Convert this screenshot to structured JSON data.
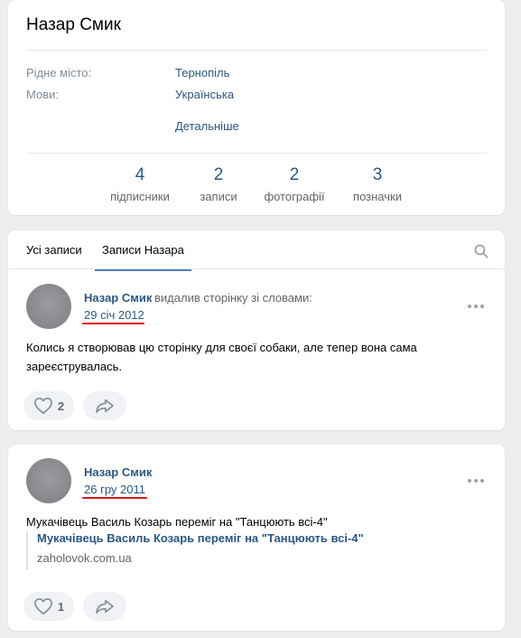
{
  "profile": {
    "name": "Назар Смик",
    "info": [
      {
        "label": "Рідне місто:",
        "value": "Тернопіль"
      },
      {
        "label": "Мови:",
        "value": "Українська"
      }
    ],
    "more_link": "Детальніше",
    "counters": [
      {
        "num": "4",
        "label": "підписники"
      },
      {
        "num": "2",
        "label": "записи"
      },
      {
        "num": "2",
        "label": "фотографії"
      },
      {
        "num": "3",
        "label": "позначки"
      }
    ]
  },
  "wall": {
    "tabs": [
      "Усі записи",
      "Записи Назара"
    ],
    "active_tab": "Записи Назара",
    "search_icon": "search-icon"
  },
  "posts": [
    {
      "author": "Назар Смик",
      "action": "видалив сторінку зі словами:",
      "date": "29 січ 2012",
      "text": "Колись я створював цю сторінку для своєї собаки, але тепер вона сама зареєструвалась.",
      "likes": "2"
    },
    {
      "author": "Назар Смик",
      "action": "",
      "date": "26 гру 2011",
      "text": "Мукачівець Василь Козарь переміг на \"Танцюють всі-4\"",
      "link_title": "Мукачівець Василь Козарь переміг на \"Танцюють всі-4\"",
      "link_domain": "zaholovok.com.ua",
      "likes": "1"
    }
  ],
  "colors": {
    "accent": "#2a5885",
    "underline": "#e01818",
    "background": "#edeef0"
  }
}
